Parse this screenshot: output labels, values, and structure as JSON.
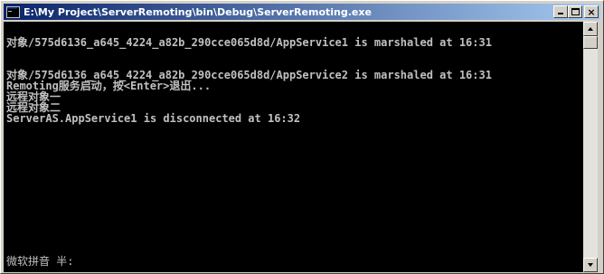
{
  "window": {
    "title": "E:\\My Project\\ServerRemoting\\bin\\Debug\\ServerRemoting.exe",
    "icon": "console-window-icon",
    "controls": {
      "minimize": "minimize-icon",
      "maximize": "maximize-icon",
      "close": "×"
    }
  },
  "console": {
    "lines": [
      "",
      "对象/575d6136_a645_4224_a82b_290cce065d8d/AppService1 is marshaled at 16:31",
      "",
      "",
      "对象/575d6136_a645_4224_a82b_290cce065d8d/AppService2 is marshaled at 16:31",
      "Remoting服务启动，按<Enter>退出...",
      "远程对象一",
      "远程对象二",
      "ServerAS.AppService1 is disconnected at 16:32"
    ],
    "ime_status": "微软拼音 半:"
  },
  "colors": {
    "console_bg": "#000000",
    "console_text": "#c0c0c0",
    "title_start": "#0a246a",
    "title_end": "#a6caf0",
    "chrome": "#d4d0c8"
  }
}
